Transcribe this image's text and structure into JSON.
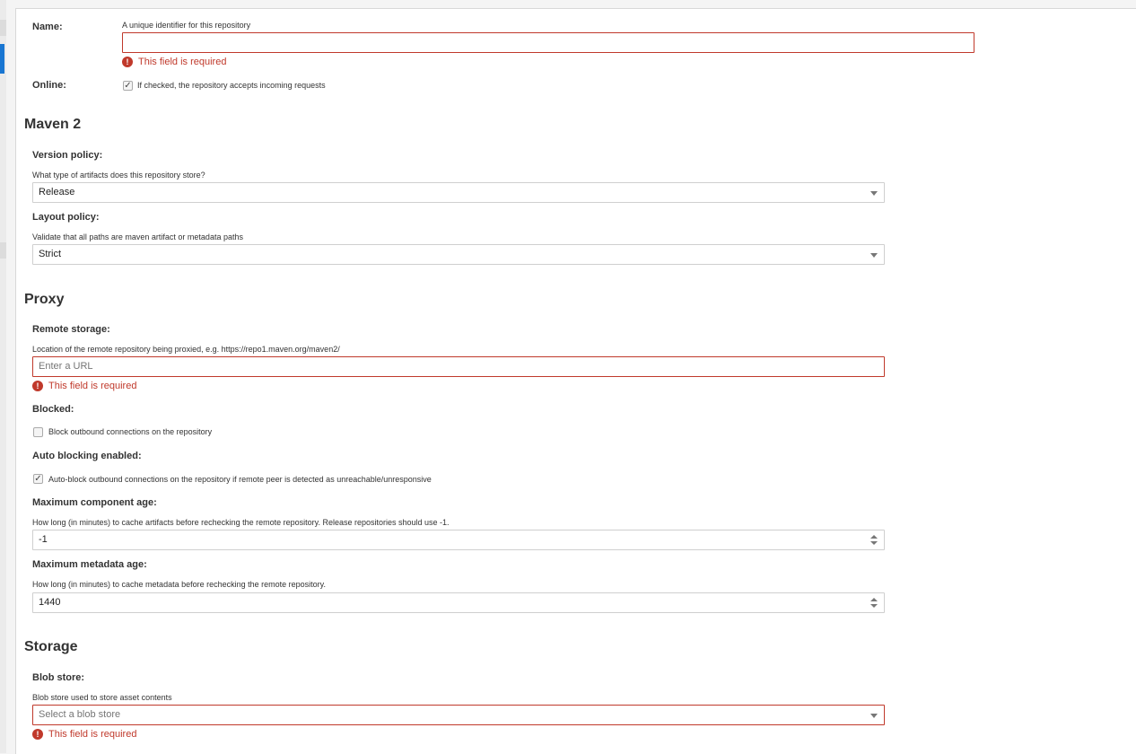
{
  "general": {
    "name": {
      "label": "Name:",
      "help": "A unique identifier for this repository",
      "value": "",
      "error": "This field is required"
    },
    "online": {
      "label": "Online:",
      "checked": true,
      "text": "If checked, the repository accepts incoming requests"
    }
  },
  "maven": {
    "title": "Maven 2",
    "version_policy": {
      "label": "Version policy:",
      "help": "What type of artifacts does this repository store?",
      "value": "Release"
    },
    "layout_policy": {
      "label": "Layout policy:",
      "help": "Validate that all paths are maven artifact or metadata paths",
      "value": "Strict"
    }
  },
  "proxy": {
    "title": "Proxy",
    "remote_storage": {
      "label": "Remote storage:",
      "help": "Location of the remote repository being proxied, e.g. https://repo1.maven.org/maven2/",
      "placeholder": "Enter a URL",
      "error": "This field is required"
    },
    "blocked": {
      "label": "Blocked:",
      "checked": false,
      "text": "Block outbound connections on the repository"
    },
    "auto_blocking": {
      "label": "Auto blocking enabled:",
      "checked": true,
      "text": "Auto-block outbound connections on the repository if remote peer is detected as unreachable/unresponsive"
    },
    "max_component_age": {
      "label": "Maximum component age:",
      "help": "How long (in minutes) to cache artifacts before rechecking the remote repository. Release repositories should use -1.",
      "value": "-1"
    },
    "max_metadata_age": {
      "label": "Maximum metadata age:",
      "help": "How long (in minutes) to cache metadata before rechecking the remote repository.",
      "value": "1440"
    }
  },
  "storage": {
    "title": "Storage",
    "blob_store": {
      "label": "Blob store:",
      "help": "Blob store used to store asset contents",
      "placeholder": "Select a blob store",
      "error": "This field is required"
    }
  },
  "icons": {
    "error": "exclamation-circle-icon",
    "check": "checkmark-icon",
    "dropdown": "chevron-down-icon",
    "spinner": "spinner-arrows-icon"
  },
  "colors": {
    "error": "#c0392b",
    "nav_active": "#1976d2",
    "border": "#cfcfcf"
  }
}
